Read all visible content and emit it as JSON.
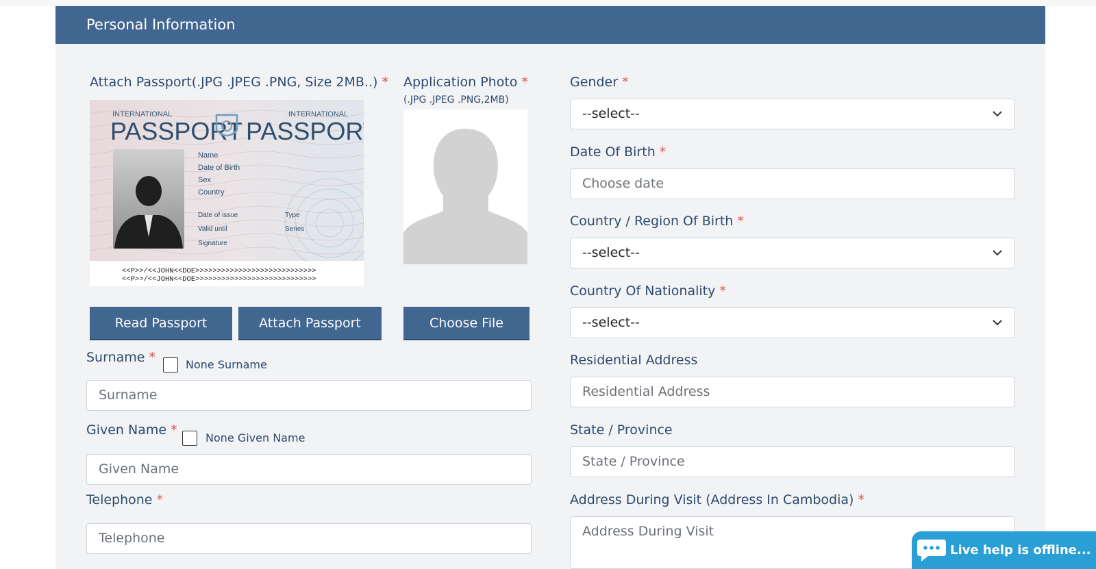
{
  "section": {
    "title": "Personal Information"
  },
  "passport": {
    "label": "Attach Passport(.JPG .JPEG .PNG, Size 2MB..)",
    "required": "*",
    "image": {
      "intl_left": "INTERNATIONAL",
      "intl_right": "INTERNATIONAL",
      "word_left": "PASSPORT",
      "word_right": "PASSPORT",
      "fields": [
        "Name",
        "Date of Birth",
        "Sex",
        "Country"
      ],
      "fields_bottom_left": [
        "Date of issue",
        "Valid until",
        "Signature"
      ],
      "fields_bottom_right": [
        "Type",
        "Series"
      ],
      "mrz1": "<<P>>/<<JOHN<<DOE>>>>>>>>>>>>>>>>>>>>>>>>>>>>",
      "mrz2": "<<P>>/<<JOHN<<DOE>>>>>>>>>>>>>>>>>>>>>>>>>>>>"
    },
    "read_button": "Read Passport",
    "attach_button": "Attach Passport"
  },
  "photo": {
    "label": "Application Photo",
    "required": "*",
    "sub": "(.JPG .JPEG .PNG,2MB)",
    "choose_button": "Choose File"
  },
  "surname": {
    "label": "Surname",
    "required": "*",
    "none_label": "None Surname",
    "placeholder": "Surname"
  },
  "given": {
    "label": "Given Name",
    "required": "*",
    "none_label": "None Given Name",
    "placeholder": "Given Name"
  },
  "telephone": {
    "label": "Telephone",
    "required": "*",
    "placeholder": "Telephone"
  },
  "gender": {
    "label": "Gender",
    "required": "*",
    "value": "--select--"
  },
  "dob": {
    "label": "Date Of Birth",
    "required": "*",
    "placeholder": "Choose date"
  },
  "country_birth": {
    "label": "Country / Region Of Birth",
    "required": "*",
    "value": "--select--"
  },
  "nationality": {
    "label": "Country Of Nationality",
    "required": "*",
    "value": "--select--"
  },
  "residential": {
    "label": "Residential Address",
    "placeholder": "Residential Address"
  },
  "state": {
    "label": "State / Province",
    "placeholder": "State / Province"
  },
  "visit_address": {
    "label": "Address During Visit (Address In Cambodia)",
    "required": "*",
    "placeholder": "Address During Visit"
  },
  "livehelp": {
    "text": "Live help is offline..."
  },
  "colors": {
    "header": "#41668f",
    "button": "#41668f",
    "required": "#d9534f",
    "livehelp": "#2a9fd6"
  }
}
